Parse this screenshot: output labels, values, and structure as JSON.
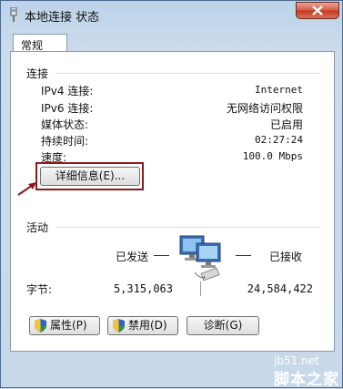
{
  "window": {
    "title": "本地连接 状态"
  },
  "tabs": [
    {
      "label": "常规"
    }
  ],
  "connection": {
    "group_label": "连接",
    "rows": [
      {
        "label": "IPv4 连接:",
        "value": "Internet"
      },
      {
        "label": "IPv6 连接:",
        "value": "无网络访问权限"
      },
      {
        "label": "媒体状态:",
        "value": "已启用"
      },
      {
        "label": "持续时间:",
        "value": "02:27:24"
      },
      {
        "label": "速度:",
        "value": "100.0 Mbps"
      }
    ],
    "details_button": "详细信息(E)..."
  },
  "activity": {
    "group_label": "活动",
    "sent_label": "已发送",
    "received_label": "已接收",
    "bytes_label": "字节:",
    "bytes_sent": "5,315,063",
    "bytes_received": "24,584,422"
  },
  "buttons": {
    "properties": "属性(P)",
    "disable": "禁用(D)",
    "diagnose": "诊断(G)"
  },
  "watermark": {
    "line1": "jb51.net",
    "line2": "脚本之家"
  },
  "colors": {
    "highlight_box": "#8b1a1a",
    "close_button": "#c1391f"
  }
}
